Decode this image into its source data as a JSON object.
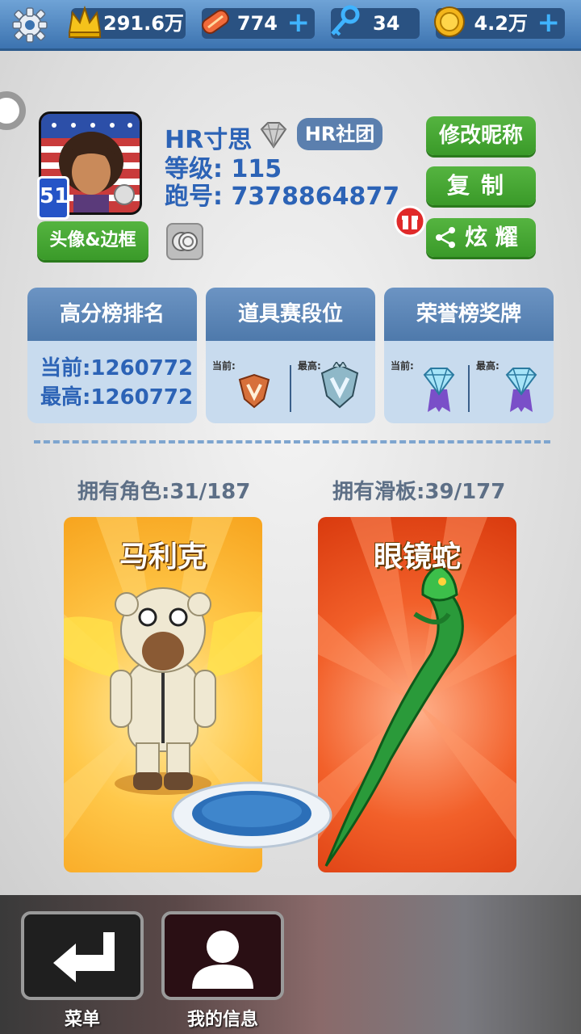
{
  "topbar": {
    "score": "291.6万",
    "boards": "774",
    "keys": "34",
    "coins": "4.2万"
  },
  "profile": {
    "name": "HR寸思",
    "club": "HR社团",
    "level": "等级: 115",
    "runner_id": "跑号: 7378864877",
    "avatar_level": "51"
  },
  "buttons": {
    "edit_nickname": "修改昵称",
    "copy": "复制",
    "share": "炫 耀",
    "avatar_frame": "头像&边框"
  },
  "cards": {
    "score_rank": {
      "title": "高分榜排名",
      "current": "当前:1260772",
      "best": "最高:1260772"
    },
    "item_tier": {
      "title": "道具赛段位",
      "current_label": "当前:",
      "best_label": "最高:"
    },
    "honor_medal": {
      "title": "荣誉榜奖牌",
      "current_label": "当前:",
      "best_label": "最高:"
    }
  },
  "owned": {
    "characters": "拥有角色:31/187",
    "boards": "拥有滑板:39/177"
  },
  "showcase": {
    "character_name": "马利克",
    "board_name": "眼镜蛇"
  },
  "nav": {
    "menu": "菜单",
    "my_info": "我的信息"
  },
  "colors": {
    "accent_blue": "#2c63b6",
    "green_button": "#4aa835",
    "card_header": "#5b84b5"
  }
}
